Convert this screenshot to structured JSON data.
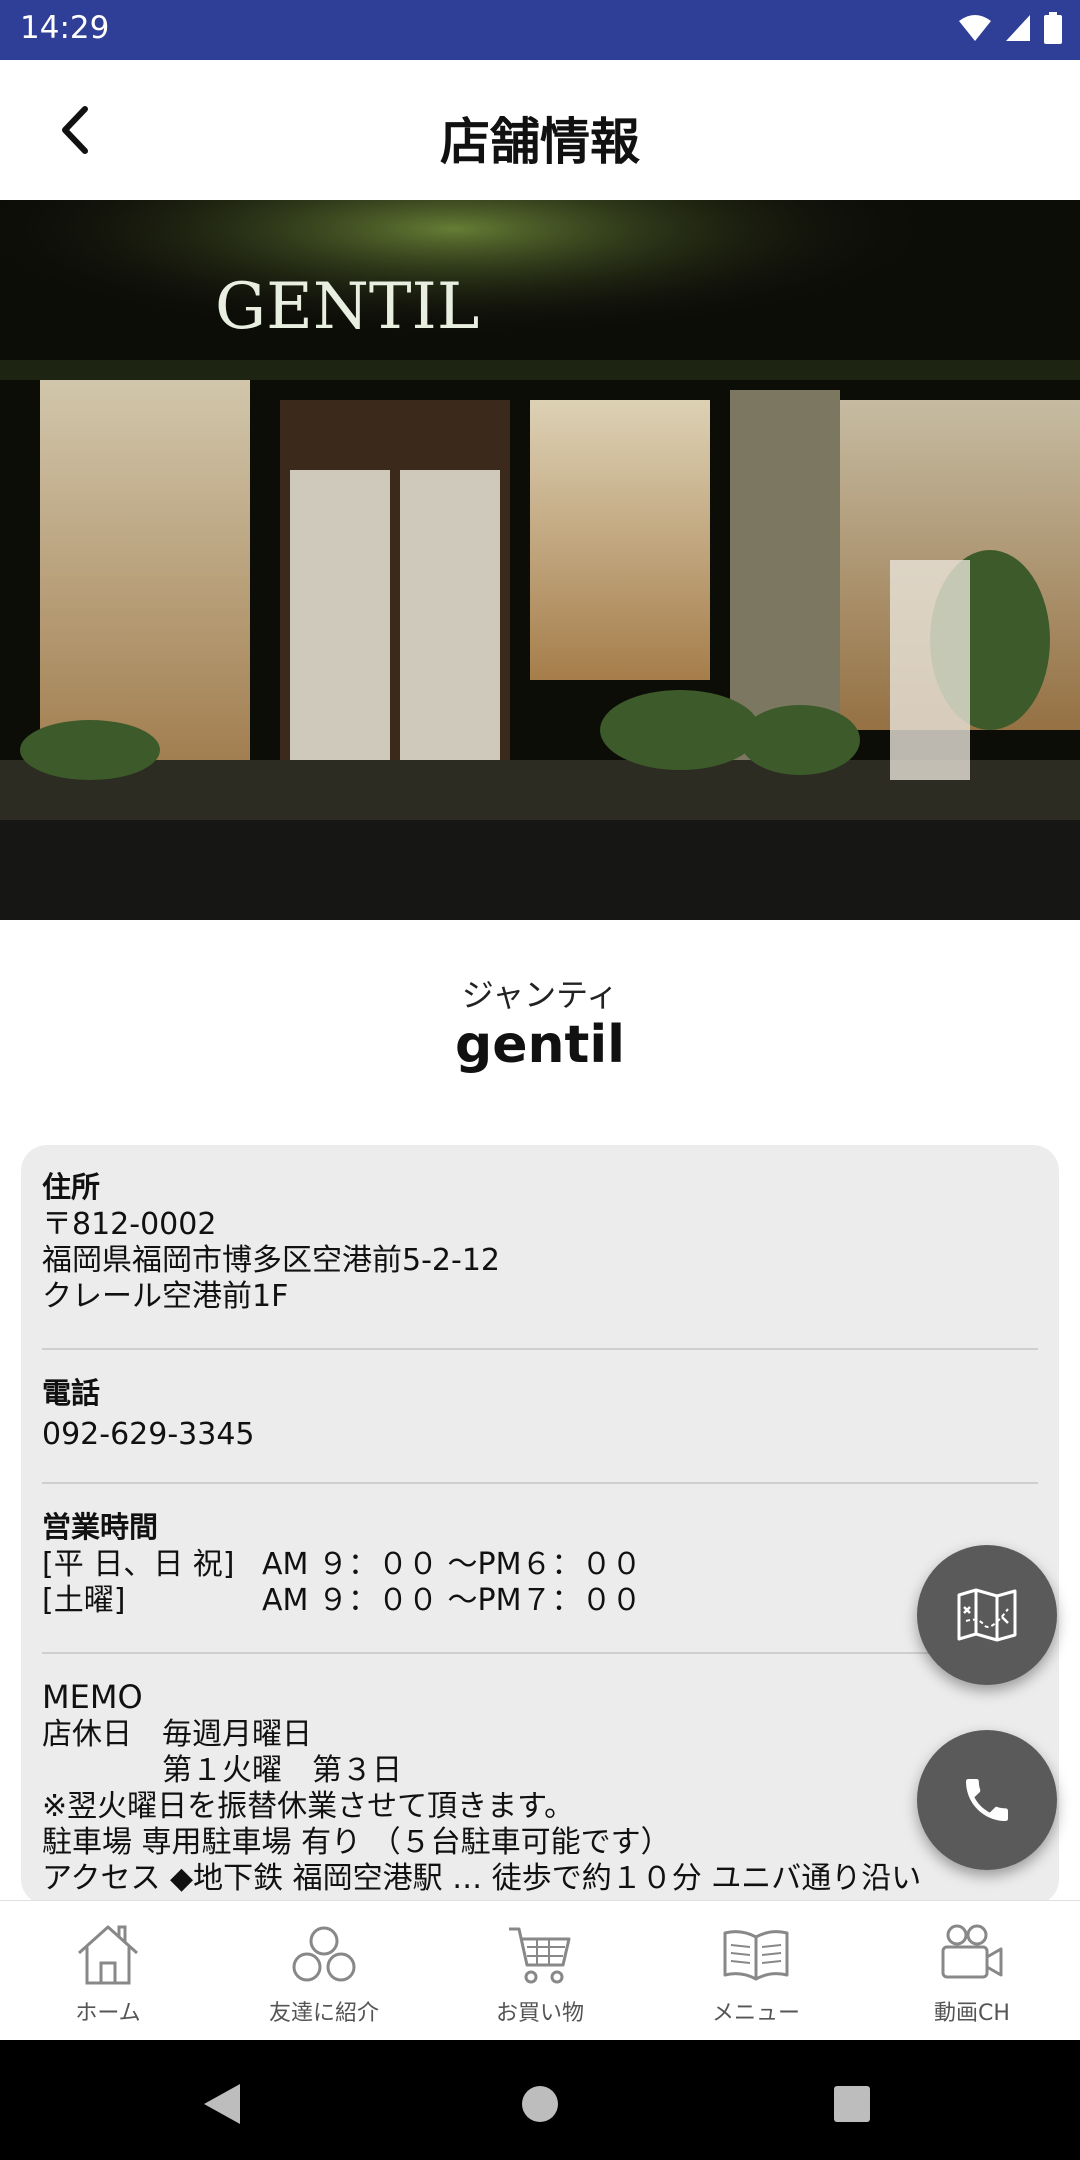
{
  "status_bar": {
    "time": "14:29"
  },
  "app_bar": {
    "title": "店舗情報"
  },
  "hero": {
    "sign_text": "GENTIL"
  },
  "store": {
    "name_kana": "ジャンティ",
    "name": "gentil"
  },
  "info": {
    "address": {
      "label": "住所",
      "lines": [
        "〒812-0002",
        "福岡県福岡市博多区空港前5-2-12",
        "クレール空港前1F"
      ]
    },
    "phone": {
      "label": "電話",
      "value": "092-629-3345"
    },
    "hours": {
      "label": "営業時間",
      "rows": [
        {
          "day": "[平 日、日 祝]",
          "time": "AM ９：００ ～PM６：００"
        },
        {
          "day": "[土曜]",
          "time": "AM ９：００ ～PM７：００"
        }
      ]
    },
    "memo": {
      "label": "MEMO",
      "lines": [
        "店休日　毎週月曜日",
        "　　　　第１火曜　第３日",
        "※翌火曜日を振替休業させて頂きます。",
        "駐車場 専用駐車場 有り （５台駐車可能です）",
        "アクセス ◆地下鉄 福岡空港駅 … 徒歩で約１０分 ユニバ通り沿い"
      ]
    }
  },
  "fabs": {
    "map_icon": "map-icon",
    "phone_icon": "phone-icon"
  },
  "bottom_nav": [
    {
      "label": "ホーム",
      "icon": "home-icon"
    },
    {
      "label": "友達に紹介",
      "icon": "share-friends-icon"
    },
    {
      "label": "お買い物",
      "icon": "cart-icon"
    },
    {
      "label": "メニュー",
      "icon": "book-icon"
    },
    {
      "label": "動画CH",
      "icon": "video-camera-icon"
    }
  ],
  "colors": {
    "status_bar": "#2f3e96",
    "fab": "#5a5a5a",
    "card": "#ececec"
  }
}
